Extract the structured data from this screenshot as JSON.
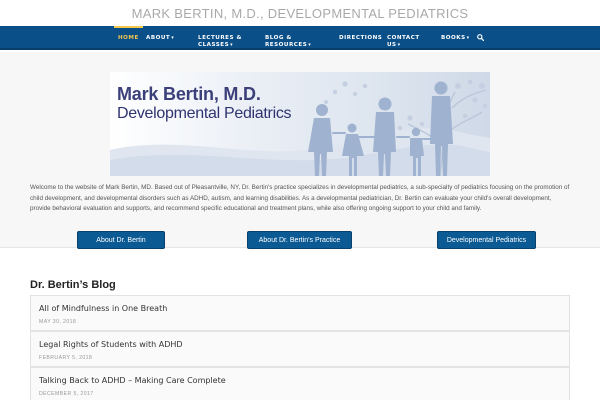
{
  "site": {
    "title": "MARK BERTIN, M.D., DEVELOPMENTAL PEDIATRICS"
  },
  "nav": {
    "items": [
      {
        "label": "HOME",
        "active": true,
        "dropdown": false
      },
      {
        "label": "ABOUT",
        "dropdown": true
      },
      {
        "label": "LECTURES &",
        "label2": "CLASSES",
        "dropdown": true
      },
      {
        "label": "BLOG &",
        "label2": "RESOURCES",
        "dropdown": true
      },
      {
        "label": "DIRECTIONS",
        "dropdown": false
      },
      {
        "label": "CONTACT",
        "label2": "US",
        "dropdown": true
      },
      {
        "label": "BOOKS",
        "dropdown": true
      }
    ],
    "search_icon": "search-icon",
    "colors": {
      "bar": "#0b4f88",
      "active": "#f2c84b"
    }
  },
  "banner": {
    "line1": "Mark Bertin, M.D.",
    "line2": "Developmental Pediatrics"
  },
  "intro": {
    "text": "Welcome to the website of Mark Bertin, MD. Based out of Pleasantville, NY, Dr. Bertin's practice specializes in developmental pediatrics, a sub-specialty of pediatrics focusing on the promotion of child development, and developmental disorders such as ADHD, autism, and learning disabilities. As a developmental pediatrician, Dr. Bertin can evaluate your child's overall development, provide behavioral evaluation and supports, and recommend specific educational and treatment plans, while also offering ongoing support to your child and family."
  },
  "cta": [
    {
      "label": "About Dr. Bertin"
    },
    {
      "label": "About Dr. Bertin's Practice"
    },
    {
      "label": "Developmental Pediatrics"
    }
  ],
  "blog": {
    "heading": "Dr. Bertin’s Blog",
    "posts": [
      {
        "title": "All of Mindfulness in One Breath",
        "date": "MAY 30, 2018"
      },
      {
        "title": "Legal Rights of Students with ADHD",
        "date": "FEBRUARY 5, 2018"
      },
      {
        "title": "Talking Back to ADHD – Making Care Complete",
        "date": "DECEMBER 5, 2017"
      }
    ]
  }
}
